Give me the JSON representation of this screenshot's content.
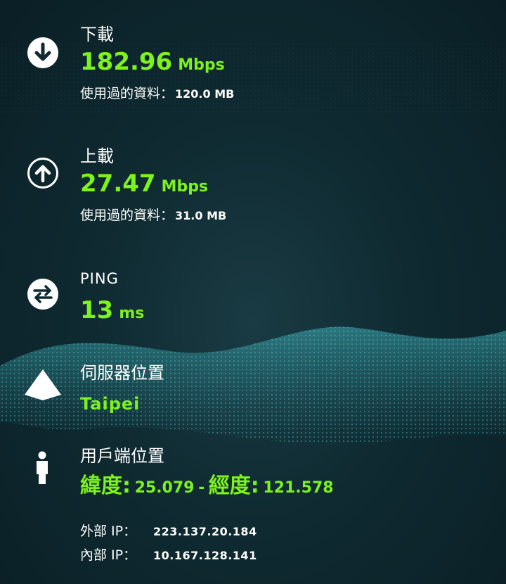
{
  "download": {
    "label": "下載",
    "value": "182.96",
    "unit": "Mbps",
    "used_label": "使用過的資料：",
    "used_value": "120.0 MB",
    "icon": "arrow-down-circle-icon"
  },
  "upload": {
    "label": "上載",
    "value": "27.47",
    "unit": "Mbps",
    "used_label": "使用過的資料：",
    "used_value": "31.0 MB",
    "icon": "arrow-up-circle-icon"
  },
  "ping": {
    "label": "PING",
    "value": "13",
    "unit": "ms",
    "icon": "swap-arrows-circle-icon"
  },
  "server": {
    "label": "伺服器位置",
    "city": "Taipei",
    "icon": "server-location-icon"
  },
  "client": {
    "label": "用戶端位置",
    "lat_label": "緯度:",
    "lat_value": "25.079",
    "separator": "-",
    "lng_label": "經度:",
    "lng_value": "121.578",
    "icon": "person-icon"
  },
  "ip": {
    "external_label": "外部 IP：",
    "external_value": "223.137.20.184",
    "internal_label": "內部 IP：",
    "internal_value": "10.167.128.141"
  },
  "colors": {
    "accent": "#7df21c",
    "background": "#0f2a31",
    "text": "#ffffff"
  }
}
